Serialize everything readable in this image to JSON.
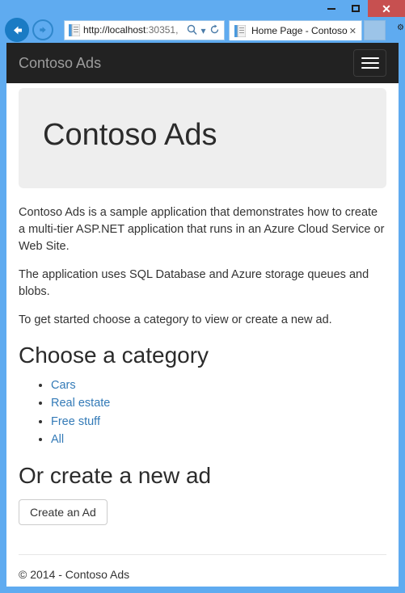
{
  "browser": {
    "window_controls": {
      "minimize_label": "Minimize",
      "maximize_label": "Maximize",
      "close_label": "✕"
    },
    "back_label": "←",
    "forward_label": "→",
    "address": {
      "scheme_and_host": "http://localhost",
      "port_and_path": ":30351,",
      "search_icon": "search-icon",
      "dropdown_icon": "chevron-down-icon",
      "refresh_icon": "refresh-icon",
      "refresh_glyph": "↻",
      "search_glyph": "⚲",
      "caret_glyph": "▾"
    },
    "tab": {
      "title": "Home Page - Contoso...",
      "close_glyph": "✕"
    },
    "frame_color": "#5fabf0",
    "close_button_color": "#c75050"
  },
  "site": {
    "navbar": {
      "brand": "Contoso Ads",
      "toggle_name": "hamburger-icon",
      "background_color": "#222222",
      "brand_color": "#9d9d9d"
    },
    "jumbotron": {
      "title": "Contoso Ads",
      "background_color": "#eeeeee"
    },
    "intro": {
      "paragraph1": "Contoso Ads is a sample application that demonstrates how to create a multi-tier ASP.NET application that runs in an Azure Cloud Service or Web Site.",
      "paragraph2": "The application uses SQL Database and Azure storage queues and blobs.",
      "paragraph3": "To get started choose a category to view or create a new ad."
    },
    "categories": {
      "heading": "Choose a category",
      "items": [
        {
          "label": "Cars"
        },
        {
          "label": "Real estate"
        },
        {
          "label": "Free stuff"
        },
        {
          "label": "All"
        }
      ],
      "link_color": "#337ab7"
    },
    "create": {
      "heading": "Or create a new ad",
      "button_label": "Create an Ad"
    },
    "footer": {
      "text": "© 2014 - Contoso Ads"
    }
  }
}
